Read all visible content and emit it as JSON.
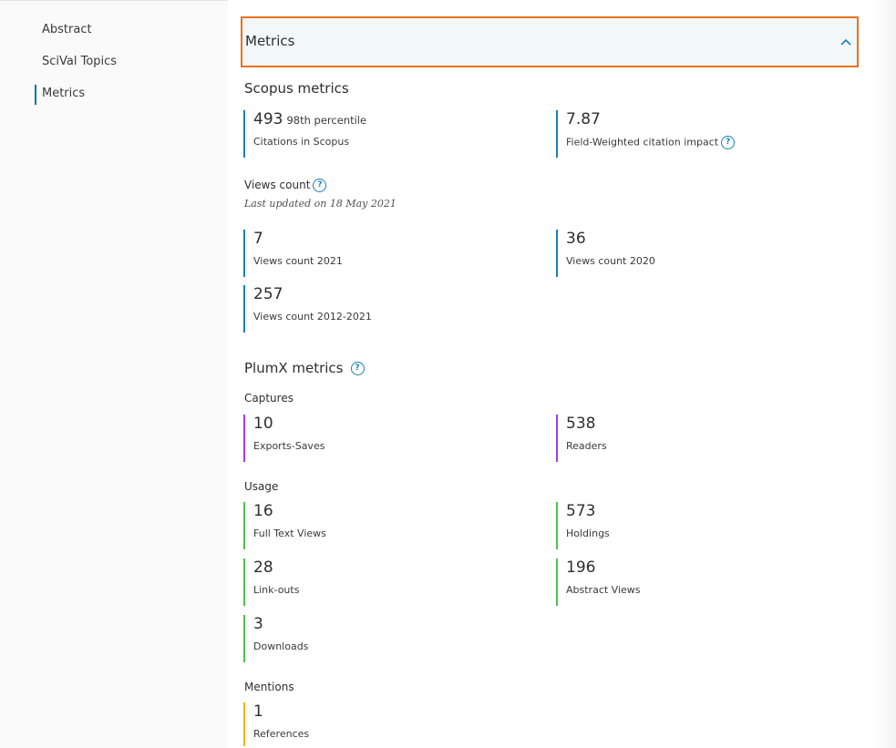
{
  "sidebar": {
    "items": [
      {
        "label": "Abstract"
      },
      {
        "label": "SciVal Topics"
      },
      {
        "label": "Metrics"
      }
    ]
  },
  "accordion": {
    "title": "Metrics"
  },
  "scopus": {
    "title": "Scopus metrics",
    "citations": {
      "value": "493",
      "percentile": "98th percentile",
      "label": "Citations in Scopus"
    },
    "fwci": {
      "value": "7.87",
      "label": "Field-Weighted citation impact"
    },
    "views_title": "Views count",
    "views_note": "Last updated on 18 May 2021",
    "views": [
      {
        "value": "7",
        "label": "Views count 2021"
      },
      {
        "value": "36",
        "label": "Views count 2020"
      },
      {
        "value": "257",
        "label": "Views count 2012-2021"
      }
    ]
  },
  "plumx": {
    "title": "PlumX metrics",
    "captures": {
      "title": "Captures",
      "items": [
        {
          "value": "10",
          "label": "Exports-Saves"
        },
        {
          "value": "538",
          "label": "Readers"
        }
      ]
    },
    "usage": {
      "title": "Usage",
      "items": [
        {
          "value": "16",
          "label": "Full Text Views"
        },
        {
          "value": "573",
          "label": "Holdings"
        },
        {
          "value": "28",
          "label": "Link-outs"
        },
        {
          "value": "196",
          "label": "Abstract Views"
        },
        {
          "value": "3",
          "label": "Downloads"
        }
      ]
    },
    "mentions": {
      "title": "Mentions",
      "items": [
        {
          "value": "1",
          "label": "References"
        }
      ]
    }
  },
  "icons": {
    "help": "?"
  },
  "colors": {
    "scopus_bar": "#1a7fb5",
    "captures_bar": "#a93ae0",
    "usage_bar": "#4fc24a",
    "mentions_bar": "#f5b400",
    "focus_border": "#e9711c",
    "active_nav": "#007398"
  }
}
